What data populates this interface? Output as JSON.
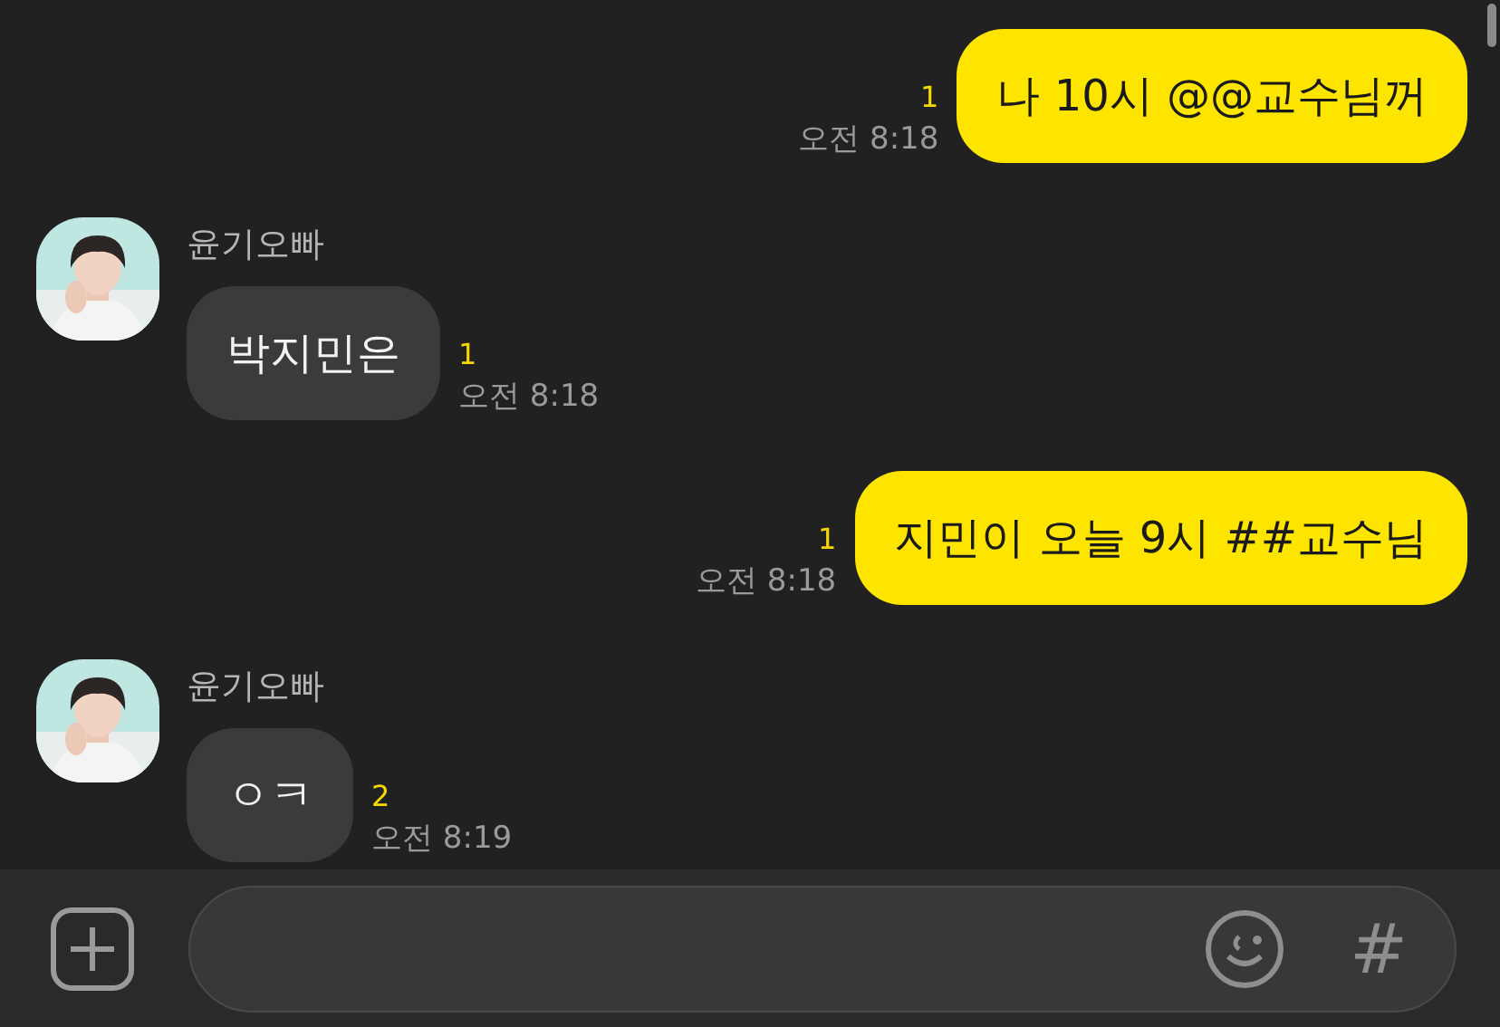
{
  "messages": [
    {
      "kind": "me",
      "text": "나 10시 @@교수님꺼",
      "unread": "1",
      "time": "오전 8:18"
    },
    {
      "kind": "other",
      "sender": "윤기오빠",
      "text": "박지민은",
      "unread": "1",
      "time": "오전 8:18"
    },
    {
      "kind": "me",
      "text": "지민이 오늘 9시 ##교수님",
      "unread": "1",
      "time": "오전 8:18"
    },
    {
      "kind": "other",
      "sender": "윤기오빠",
      "text": "ㅇㅋ",
      "unread": "2",
      "time": "오전 8:19"
    }
  ],
  "composer": {
    "hash": "#"
  }
}
